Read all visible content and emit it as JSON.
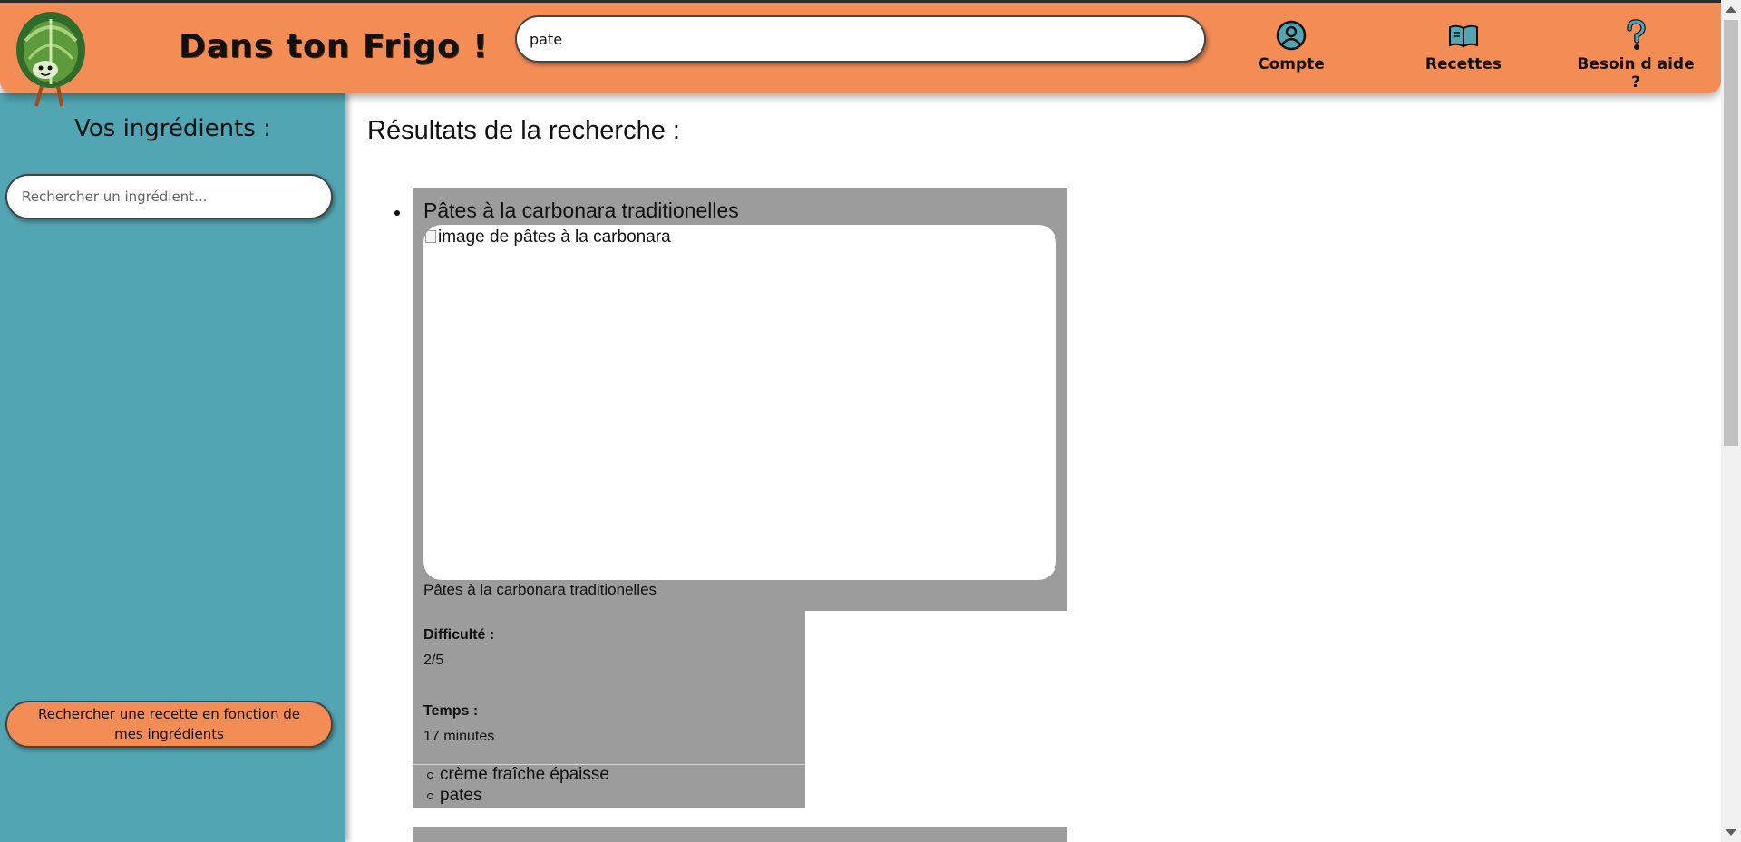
{
  "header": {
    "site_title": "Dans ton Frigo !",
    "search_value": "pate",
    "nav": [
      {
        "label": "Compte",
        "icon": "user-icon"
      },
      {
        "label": "Recettes",
        "icon": "book-icon"
      },
      {
        "label": "Besoin d aide ?",
        "icon": "question-icon"
      }
    ]
  },
  "sidebar": {
    "title": "Vos ingrédients :",
    "search_placeholder": "Rechercher un ingrédient...",
    "search_button_label": "Rechercher une recette en fonction de mes ingrédients"
  },
  "main": {
    "results_title": "Résultats de la recherche :",
    "recipes": [
      {
        "name": "Pâtes à la carbonara traditionelles",
        "image_alt": "image de pâtes à la carbonara",
        "caption": "Pâtes à la carbonara traditionelles",
        "difficulty_label": "Difficulté :",
        "difficulty_value": "2/5",
        "time_label": "Temps :",
        "time_value": "17 minutes",
        "ingredients": [
          "crème fraîche épaisse",
          "pates"
        ]
      }
    ]
  },
  "colors": {
    "header_bg": "#f48c56",
    "sidebar_bg": "#52a5b2",
    "card_bg": "#9c9c9c"
  }
}
